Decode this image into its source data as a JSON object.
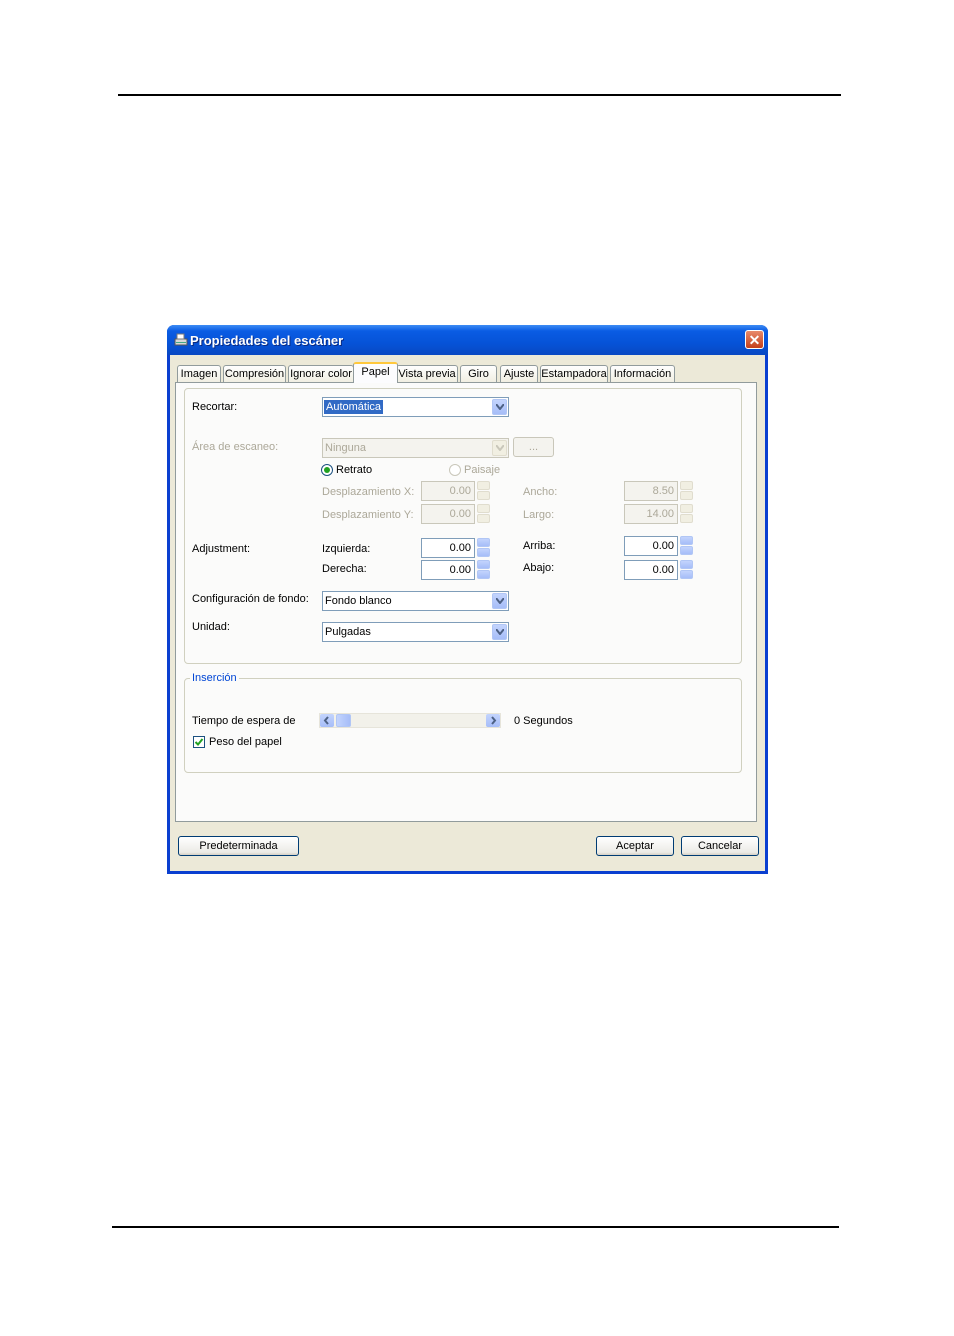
{
  "window": {
    "title": "Propiedades del escáner",
    "close_glyph": "✕"
  },
  "tabs": [
    "Imagen",
    "Compresión",
    "Ignorar color",
    "Papel",
    "Vista previa",
    "Giro",
    "Ajuste",
    "Estampadora",
    "Información"
  ],
  "active_tab": "Papel",
  "paper": {
    "recortar": {
      "label": "Recortar:",
      "value": "Automática"
    },
    "area": {
      "label": "Área de escaneo:",
      "value": "Ninguna",
      "button": "..."
    },
    "orientation": {
      "portrait": "Retrato",
      "landscape": "Paisaje",
      "selected": "Retrato"
    },
    "offset_x": {
      "label": "Desplazamiento X:",
      "value": "0.00"
    },
    "offset_y": {
      "label": "Desplazamiento Y:",
      "value": "0.00"
    },
    "width": {
      "label": "Ancho:",
      "value": "8.50"
    },
    "length": {
      "label": "Largo:",
      "value": "14.00"
    },
    "adjustment": {
      "label": "Adjustment:",
      "left": {
        "label": "Izquierda:",
        "value": "0.00"
      },
      "right": {
        "label": "Derecha:",
        "value": "0.00"
      },
      "top": {
        "label": "Arriba:",
        "value": "0.00"
      },
      "bottom": {
        "label": "Abajo:",
        "value": "0.00"
      }
    },
    "background": {
      "label": "Configuración de fondo:",
      "value": "Fondo blanco"
    },
    "unit": {
      "label": "Unidad:",
      "value": "Pulgadas"
    }
  },
  "insertion": {
    "group_label": "Inserción",
    "timeout": {
      "label": "Tiempo de espera de",
      "value": "0 Segundos",
      "slider_fraction": 0
    },
    "paper_weight": {
      "label": "Peso del papel",
      "checked": true
    }
  },
  "buttons": {
    "default": "Predeterminada",
    "ok": "Aceptar",
    "cancel": "Cancelar"
  },
  "colors": {
    "titlebar": "#0653d8",
    "selection": "#316ac5",
    "tab_accent": "#ffc83c",
    "check": "#21a121"
  },
  "icons": {
    "title": "scanner-icon",
    "close": "close-icon"
  }
}
